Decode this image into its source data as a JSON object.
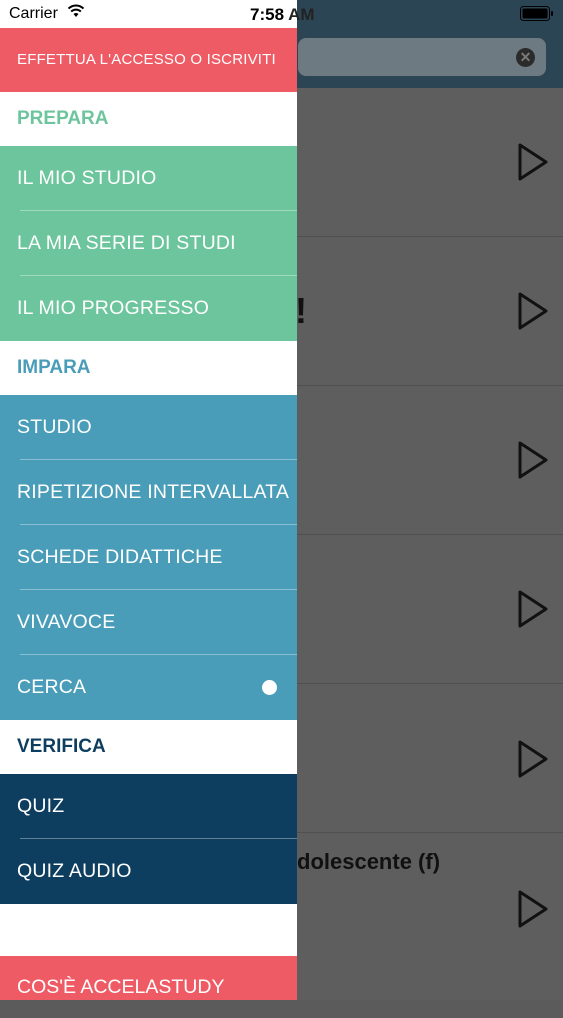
{
  "status_bar": {
    "carrier": "Carrier",
    "time": "7:58",
    "ampm": "AM"
  },
  "background": {
    "search_clear_glyph": "✕",
    "visible_row_text": "dolescente (f)",
    "partial_glyph": "!"
  },
  "drawer": {
    "login_label": "EFFETTUA L'ACCESSO O ISCRIVITI",
    "sections": {
      "prepara": {
        "title": "PREPARA",
        "items": [
          "IL MIO STUDIO",
          "LA MIA SERIE DI STUDI",
          "IL MIO PROGRESSO"
        ]
      },
      "impara": {
        "title": "IMPARA",
        "items": [
          "STUDIO",
          "RIPETIZIONE INTERVALLATA",
          "SCHEDE DIDATTICHE",
          "VIVAVOCE",
          "CERCA"
        ],
        "selected": "CERCA"
      },
      "verifica": {
        "title": "VERIFICA",
        "items": [
          "QUIZ",
          "QUIZ AUDIO"
        ]
      }
    },
    "footer_label": "COS'È ACCELASTUDY"
  },
  "colors": {
    "login": "#ef5b65",
    "prepara": "#6cc59c",
    "impara": "#4a9db8",
    "verifica": "#0e3e5f",
    "prepara_title": "#6cc59c",
    "impara_title": "#4a9db8",
    "verifica_title": "#0e3e5f"
  }
}
